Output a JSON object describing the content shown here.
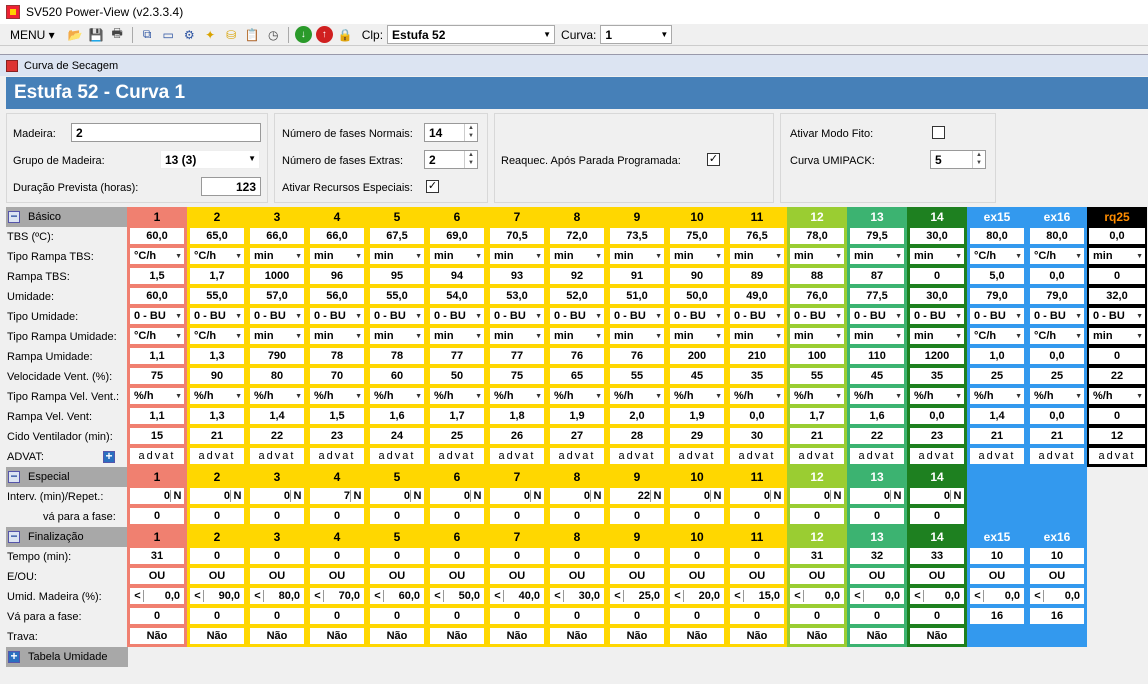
{
  "window": {
    "title": "SV520 Power-View (v2.3.3.4)"
  },
  "toolbar": {
    "menu": "MENU",
    "clp_label": "Clp:",
    "clp_value": "Estufa 52",
    "curva_label": "Curva:",
    "curva_value": "1"
  },
  "child": {
    "title": "Curva de Secagem"
  },
  "header": {
    "title": "Estufa 52 - Curva 1"
  },
  "params": {
    "madeira_label": "Madeira:",
    "madeira_value": "2",
    "grupo_label": "Grupo de Madeira:",
    "grupo_value": "13 (3)",
    "duracao_label": "Duração Prevista (horas):",
    "duracao_value": "123",
    "fases_normais_label": "Número de fases Normais:",
    "fases_normais_value": "14",
    "fases_extras_label": "Número de fases Extras:",
    "fases_extras_value": "2",
    "recursos_label": "Ativar Recursos Especiais:",
    "recursos_checked": true,
    "reaquec_label": "Reaquec. Após Parada Programada:",
    "reaquec_checked": true,
    "fito_label": "Ativar Modo Fito:",
    "fito_checked": false,
    "umipack_label": "Curva UMIPACK:",
    "umipack_value": "5"
  },
  "colors": {
    "red": "#f08070",
    "yellow": "#ffd700",
    "lightgreen": "#9acd32",
    "green": "#3cb371",
    "darkgreen": "#1e8020",
    "blue": "#3399ee",
    "black": "#000000",
    "orange": "#ff8c00"
  },
  "columns": [
    {
      "label": "1",
      "color": "red"
    },
    {
      "label": "2",
      "color": "yellow"
    },
    {
      "label": "3",
      "color": "yellow"
    },
    {
      "label": "4",
      "color": "yellow"
    },
    {
      "label": "5",
      "color": "yellow"
    },
    {
      "label": "6",
      "color": "yellow"
    },
    {
      "label": "7",
      "color": "yellow"
    },
    {
      "label": "8",
      "color": "yellow"
    },
    {
      "label": "9",
      "color": "yellow"
    },
    {
      "label": "10",
      "color": "yellow"
    },
    {
      "label": "11",
      "color": "yellow"
    },
    {
      "label": "12",
      "color": "lightgreen"
    },
    {
      "label": "13",
      "color": "green"
    },
    {
      "label": "14",
      "color": "darkgreen"
    },
    {
      "label": "ex15",
      "color": "blue"
    },
    {
      "label": "ex16",
      "color": "blue"
    },
    {
      "label": "rq25",
      "color": "black"
    }
  ],
  "sections": {
    "basico": "Básico",
    "especial": "Especial",
    "finalizacao": "Finalização",
    "tabela": "Tabela Umidade"
  },
  "basico_rows": [
    {
      "label": "TBS (ºC):",
      "type": "val",
      "values": [
        "60,0",
        "65,0",
        "66,0",
        "66,0",
        "67,5",
        "69,0",
        "70,5",
        "72,0",
        "73,5",
        "75,0",
        "76,5",
        "78,0",
        "79,5",
        "30,0",
        "80,0",
        "80,0",
        "0,0"
      ]
    },
    {
      "label": "Tipo Rampa TBS:",
      "type": "dd",
      "values": [
        "°C/h",
        "°C/h",
        "min",
        "min",
        "min",
        "min",
        "min",
        "min",
        "min",
        "min",
        "min",
        "min",
        "min",
        "min",
        "°C/h",
        "°C/h",
        "min"
      ]
    },
    {
      "label": "Rampa TBS:",
      "type": "val",
      "values": [
        "1,5",
        "1,7",
        "1000",
        "96",
        "95",
        "94",
        "93",
        "92",
        "91",
        "90",
        "89",
        "88",
        "87",
        "0",
        "5,0",
        "0,0",
        "0"
      ]
    },
    {
      "label": "Umidade:",
      "type": "val",
      "values": [
        "60,0",
        "55,0",
        "57,0",
        "56,0",
        "55,0",
        "54,0",
        "53,0",
        "52,0",
        "51,0",
        "50,0",
        "49,0",
        "76,0",
        "77,5",
        "30,0",
        "79,0",
        "79,0",
        "32,0"
      ]
    },
    {
      "label": "Tipo Umidade:",
      "type": "dd",
      "values": [
        "0 - BU",
        "0 - BU",
        "0 - BU",
        "0 - BU",
        "0 - BU",
        "0 - BU",
        "0 - BU",
        "0 - BU",
        "0 - BU",
        "0 - BU",
        "0 - BU",
        "0 - BU",
        "0 - BU",
        "0 - BU",
        "0 - BU",
        "0 - BU",
        "0 - BU"
      ]
    },
    {
      "label": "Tipo Rampa Umidade:",
      "type": "dd",
      "values": [
        "°C/h",
        "°C/h",
        "min",
        "min",
        "min",
        "min",
        "min",
        "min",
        "min",
        "min",
        "min",
        "min",
        "min",
        "min",
        "°C/h",
        "°C/h",
        "min"
      ]
    },
    {
      "label": "Rampa Umidade:",
      "type": "val",
      "values": [
        "1,1",
        "1,3",
        "790",
        "78",
        "78",
        "77",
        "77",
        "76",
        "76",
        "200",
        "210",
        "100",
        "110",
        "1200",
        "1,0",
        "0,0",
        "0"
      ]
    },
    {
      "label": "Velocidade Vent. (%):",
      "type": "val",
      "values": [
        "75",
        "90",
        "80",
        "70",
        "60",
        "50",
        "75",
        "65",
        "55",
        "45",
        "35",
        "55",
        "45",
        "35",
        "25",
        "25",
        "22"
      ]
    },
    {
      "label": "Tipo Rampa Vel. Vent.:",
      "type": "dd",
      "values": [
        "%/h",
        "%/h",
        "%/h",
        "%/h",
        "%/h",
        "%/h",
        "%/h",
        "%/h",
        "%/h",
        "%/h",
        "%/h",
        "%/h",
        "%/h",
        "%/h",
        "%/h",
        "%/h",
        "%/h"
      ]
    },
    {
      "label": "Rampa Vel. Vent:",
      "type": "val",
      "values": [
        "1,1",
        "1,3",
        "1,4",
        "1,5",
        "1,6",
        "1,7",
        "1,8",
        "1,9",
        "2,0",
        "1,9",
        "0,0",
        "1,7",
        "1,6",
        "0,0",
        "1,4",
        "0,0",
        "0"
      ]
    },
    {
      "label": "Cido Ventilador (min):",
      "type": "val",
      "values": [
        "15",
        "21",
        "22",
        "23",
        "24",
        "25",
        "26",
        "27",
        "28",
        "29",
        "30",
        "21",
        "22",
        "23",
        "21",
        "21",
        "12"
      ]
    },
    {
      "label": "ADVAT:",
      "type": "val",
      "values": [
        "advat",
        "advat",
        "advat",
        "advat",
        "advat",
        "advat",
        "advat",
        "advat",
        "advat",
        "advat",
        "advat",
        "advat",
        "advat",
        "advat",
        "advat",
        "advat",
        "advat"
      ]
    }
  ],
  "especial_rows": [
    {
      "label": "Interv. (min)/Repet.:",
      "type": "split",
      "values": [
        "0",
        "0",
        "0",
        "7",
        "0",
        "0",
        "0",
        "0",
        "22",
        "0",
        "0",
        "0",
        "0",
        "0"
      ],
      "flag": "N"
    },
    {
      "label": "vá para a fase:",
      "type": "val",
      "values": [
        "0",
        "0",
        "0",
        "0",
        "0",
        "0",
        "0",
        "0",
        "0",
        "0",
        "0",
        "0",
        "0",
        "0"
      ]
    }
  ],
  "final_cols": [
    "1",
    "2",
    "3",
    "4",
    "5",
    "6",
    "7",
    "8",
    "9",
    "10",
    "11",
    "12",
    "13",
    "14",
    "ex15",
    "ex16"
  ],
  "final_rows": [
    {
      "label": "Tempo (min):",
      "type": "val",
      "values": [
        "31",
        "0",
        "0",
        "0",
        "0",
        "0",
        "0",
        "0",
        "0",
        "0",
        "0",
        "31",
        "32",
        "33",
        "10",
        "10"
      ]
    },
    {
      "label": "E/OU:",
      "type": "val",
      "values": [
        "OU",
        "OU",
        "OU",
        "OU",
        "OU",
        "OU",
        "OU",
        "OU",
        "OU",
        "OU",
        "OU",
        "OU",
        "OU",
        "OU",
        "OU",
        "OU"
      ]
    },
    {
      "label": "Umid. Madeira (%):",
      "type": "lt",
      "values": [
        "0,0",
        "90,0",
        "80,0",
        "70,0",
        "60,0",
        "50,0",
        "40,0",
        "30,0",
        "25,0",
        "20,0",
        "15,0",
        "0,0",
        "0,0",
        "0,0",
        "0,0",
        "0,0"
      ],
      "op": "<"
    },
    {
      "label": "Vá para a fase:",
      "type": "val",
      "values": [
        "0",
        "0",
        "0",
        "0",
        "0",
        "0",
        "0",
        "0",
        "0",
        "0",
        "0",
        "0",
        "0",
        "0",
        "16",
        "16"
      ]
    },
    {
      "label": "Trava:",
      "type": "val",
      "values": [
        "Não",
        "Não",
        "Não",
        "Não",
        "Não",
        "Não",
        "Não",
        "Não",
        "Não",
        "Não",
        "Não",
        "Não",
        "Não",
        "Não"
      ]
    }
  ]
}
